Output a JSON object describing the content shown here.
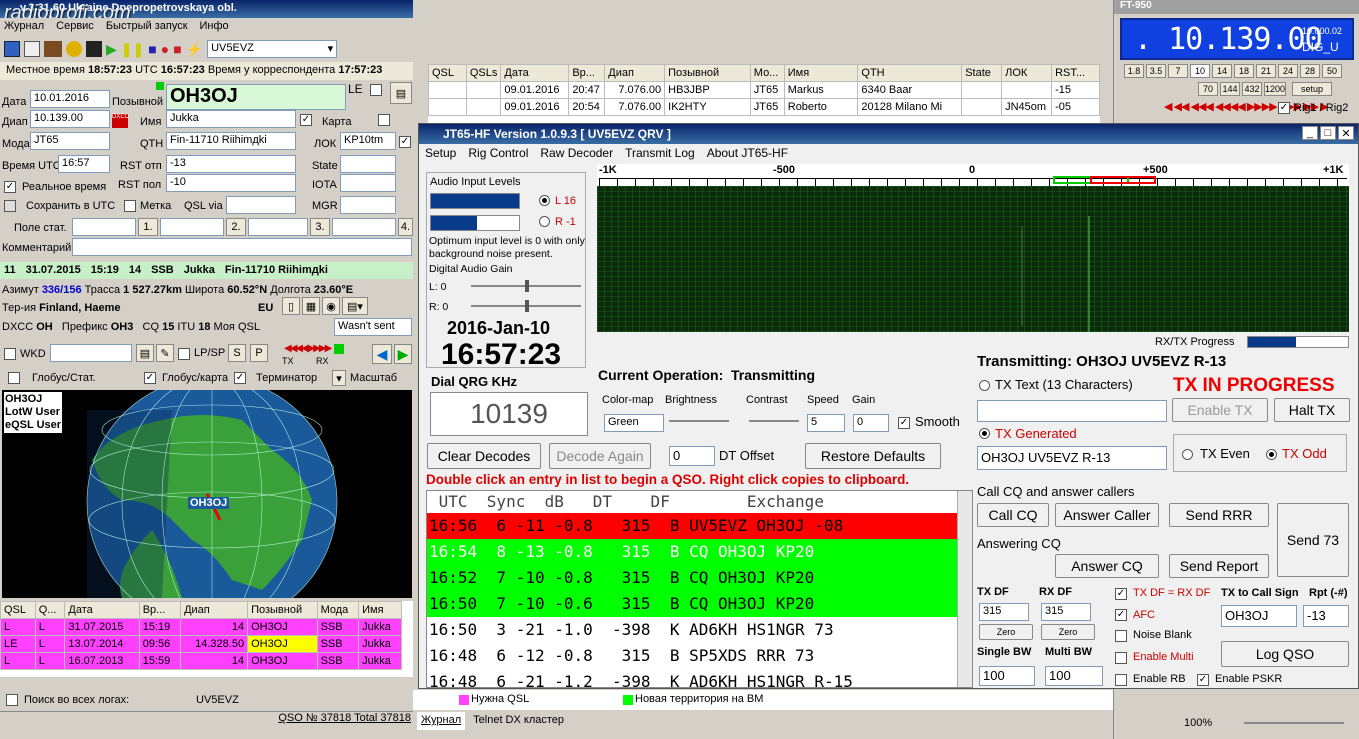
{
  "main": {
    "title": "v.3.31.60 Ukraine Dnepropetrovskaya obl.",
    "watermark": "radioprofi.com",
    "menu": [
      "Журнал",
      "Сервис",
      "Быстрый запуск",
      "Инфо"
    ],
    "callsign_select": "UV5EVZ",
    "local_time_label": "Местное время",
    "local_time": "18:57:23",
    "utc_label": "UTC",
    "utc": "16:57:23",
    "corr_time_label": "Время у корреспондента",
    "corr_time": "17:57:23",
    "date_label": "Дата",
    "date": "10.01.2016",
    "callsign_label": "Позывной",
    "callsign": "OH3OJ",
    "le": "LE",
    "band_label": "Диап",
    "band": "10.139.00",
    "name_label": "Имя",
    "name": "Jukka",
    "map_label": "Карта",
    "mode_label": "Мода",
    "mode": "JT65",
    "qth_label": "QTH",
    "qth": "Fin-11710 Riihimдki",
    "loc_label": "ЛОК",
    "loc": "KP10tm",
    "utc_time_label": "Время UTC",
    "utc_time": "16:57",
    "rst_sent_label": "RST отп",
    "rst_sent": "-13",
    "state_label": "State",
    "realtime_label": "Реальное время",
    "rst_rcvd_label": "RST пол",
    "rst_rcvd": "-10",
    "iota_label": "IOTA",
    "save_utc_label": "Сохранить в UTC",
    "mark_label": "Метка",
    "qslvia_label": "QSL via",
    "mgr_label": "MGR",
    "pole_label": "Поле стат.",
    "f1": "1.",
    "f2": "2.",
    "f3": "3.",
    "f4": "4.",
    "comment_label": "Комментарий",
    "last_qso": {
      "n": "11",
      "date": "31.07.2015",
      "time": "15:19",
      "band": "14",
      "mode": "SSB",
      "name": "Jukka",
      "qth": "Fin-11710 Riihimдki"
    },
    "az_label": "Азимут",
    "az": "336/156",
    "trace_label": "Трасса",
    "trace": "1 527.27km",
    "lat_label": "Широта",
    "lat": "60.52°N",
    "lon_label": "Долгота",
    "lon": "23.60°E",
    "terr_label": "Тер-ия",
    "terr": "Finland, Haeme",
    "cont": "EU",
    "dxcc_label": "DXCC",
    "dxcc": "OH",
    "prefix_label": "Префикс",
    "prefix": "OH3",
    "cq_label": "CQ",
    "cq": "15",
    "itu_label": "ITU",
    "itu": "18",
    "myqsl_label": "Моя QSL",
    "myqsl": "Wasn't sent",
    "wkd_label": "WKD",
    "lpsp_label": "LP/SP",
    "s": "S",
    "p": "P",
    "tx": "TX",
    "rx": "RX",
    "globe_stat_label": "Глобус/Стат.",
    "globe_map_label": "Глобус/карта",
    "term_label": "Терминатор",
    "scale_label": "Масштаб",
    "map_call": "OH3OJ",
    "map_lines": [
      "OH3OJ",
      "LotW User",
      "eQSL User"
    ],
    "hist_headers": [
      "QSL",
      "Q...",
      "Дата",
      "Вр...",
      "Диап",
      "Позывной",
      "Мода",
      "Имя"
    ],
    "hist_rows": [
      [
        "L",
        "L",
        "31.07.2015",
        "15:19",
        "14",
        "OH3OJ",
        "SSB",
        "Jukka"
      ],
      [
        "LE",
        "L",
        "13.07.2014",
        "09:56",
        "14.328.50",
        "OH3OJ",
        "SSB",
        "Jukka"
      ],
      [
        "L",
        "L",
        "16.07.2013",
        "15:59",
        "14",
        "OH3OJ",
        "SSB",
        "Jukka"
      ]
    ],
    "search_all_label": "Поиск во всех логах:",
    "search_call": "UV5EVZ",
    "qso_status": "QSO № 37818 Total 37818",
    "log_headers": [
      "QSL",
      "QSLs",
      "Дата",
      "Вр...",
      "Диап",
      "Позывной",
      "Мо...",
      "Имя",
      "QTH",
      "State",
      "ЛОК",
      "RST..."
    ],
    "log_rows": [
      [
        "",
        "",
        "09.01.2016",
        "20:47",
        "7.076.00",
        "HB3JBP",
        "JT65",
        "Markus",
        "6340 Baar",
        "",
        "",
        "-15"
      ],
      [
        "",
        "",
        "09.01.2016",
        "20:54",
        "7.076.00",
        "IK2HTY",
        "JT65",
        "Roberto",
        "20128 Milano Mi",
        "",
        "JN45om",
        "-05"
      ]
    ],
    "legend_need": "Нужна QSL",
    "legend_new": "Новая территория на ВМ",
    "tabs": [
      "Журнал",
      "Telnet DX кластер"
    ]
  },
  "rig": {
    "title": "FT-950",
    "freq": ". 10.139.00",
    "sub": "10.000.02",
    "mode": "DIG_U",
    "bands1": [
      "1.8",
      "3.5",
      "7",
      "10",
      "14",
      "18",
      "21",
      "24",
      "28",
      "50"
    ],
    "bands2": [
      "70",
      "144",
      "432",
      "1200",
      "setup"
    ],
    "rig_label": "Rig1 / Rig2",
    "zoom": "100%"
  },
  "jt": {
    "title": "JT65-HF Version 1.0.9.3  [ UV5EVZ QRV ]",
    "menu": [
      "Setup",
      "Rig Control",
      "Raw Decoder",
      "Transmit Log",
      "About JT65-HF"
    ],
    "audio_label": "Audio Input Levels",
    "l16": "L 16",
    "r1": "R -1",
    "optimum": "Optimum input level is 0 with only background noise present.",
    "gain_label": "Digital Audio Gain",
    "l0": "L: 0",
    "r0": "R: 0",
    "date": "2016-Jan-10",
    "time": "16:57:23",
    "qrg_label": "Dial QRG KHz",
    "qrg": "10139",
    "scale": [
      "-1K",
      "-500",
      "0",
      "+500",
      "+1K"
    ],
    "progress_label": "RX/TX Progress",
    "curop_label": "Current Operation:",
    "curop": "Transmitting",
    "colormap_label": "Color-map",
    "brightness_label": "Brightness",
    "contrast_label": "Contrast",
    "speed_label": "Speed",
    "gain2_label": "Gain",
    "colormap": "Green",
    "speed": "5",
    "gain": "0",
    "smooth_label": "Smooth",
    "clear": "Clear Decodes",
    "decode_again": "Decode Again",
    "dt_val": "0",
    "dt_label": "DT Offset",
    "restore": "Restore Defaults",
    "hint": "Double click an entry in list to begin a QSO.  Right click copies to clipboard.",
    "dec_header": " UTC  Sync  dB   DT    DF        Exchange",
    "decodes": [
      {
        "t": "16:56  6 -11 -0.8   315  B UV5EVZ OH3OJ -08",
        "c": "#ff0000"
      },
      {
        "t": "16:54  8 -13 -0.8   315  B CQ OH3OJ KP20",
        "c": "#00ff00"
      },
      {
        "t": "16:52  7 -10 -0.8   315  B CQ OH3OJ KP20",
        "c": "#00ff00"
      },
      {
        "t": "16:50  7 -10 -0.6   315  B CQ OH3OJ KP20",
        "c": "#00ff00"
      },
      {
        "t": "16:50  3 -21 -1.0  -398  K AD6KH HS1NGR 73",
        "c": "#ffffff"
      },
      {
        "t": "16:48  6 -12 -0.8   315  B SP5XDS RRR 73",
        "c": "#ffffff"
      },
      {
        "t": "16:48  6 -21 -1.2  -398  K AD6KH HS1NGR R-15",
        "c": "#ffffff"
      }
    ],
    "transmitting": "Transmitting: OH3OJ UV5EVZ R-13",
    "txtext_label": "TX Text (13 Characters)",
    "txinprogress": "TX IN PROGRESS",
    "enabletx": "Enable TX",
    "halttx": "Halt TX",
    "txgen_label": "TX Generated",
    "txgen": "OH3OJ UV5EVZ R-13",
    "txeven": "TX Even",
    "txodd": "TX Odd",
    "callcq_label": "Call CQ and answer callers",
    "callcq": "Call CQ",
    "answercaller": "Answer Caller",
    "sendrrr": "Send RRR",
    "send73": "Send 73",
    "answering_label": "Answering CQ",
    "answercq": "Answer CQ",
    "sendreport": "Send Report",
    "txdf_label": "TX DF",
    "rxdf_label": "RX DF",
    "txdf": "315",
    "rxdf": "315",
    "zero": "Zero",
    "txdf_rxdf": "TX DF = RX DF",
    "afc": "AFC",
    "noiseblank": "Noise Blank",
    "enablemulti": "Enable Multi",
    "enablerb": "Enable RB",
    "enablepskr": "Enable PSKR",
    "singlebw_label": "Single BW",
    "multibw_label": "Multi BW",
    "singlebw": "100",
    "multibw": "100",
    "txcall_label": "TX to Call Sign",
    "rpt_label": "Rpt (-#)",
    "txcall": "OH3OJ",
    "rpt": "-13",
    "logqso": "Log QSO"
  }
}
